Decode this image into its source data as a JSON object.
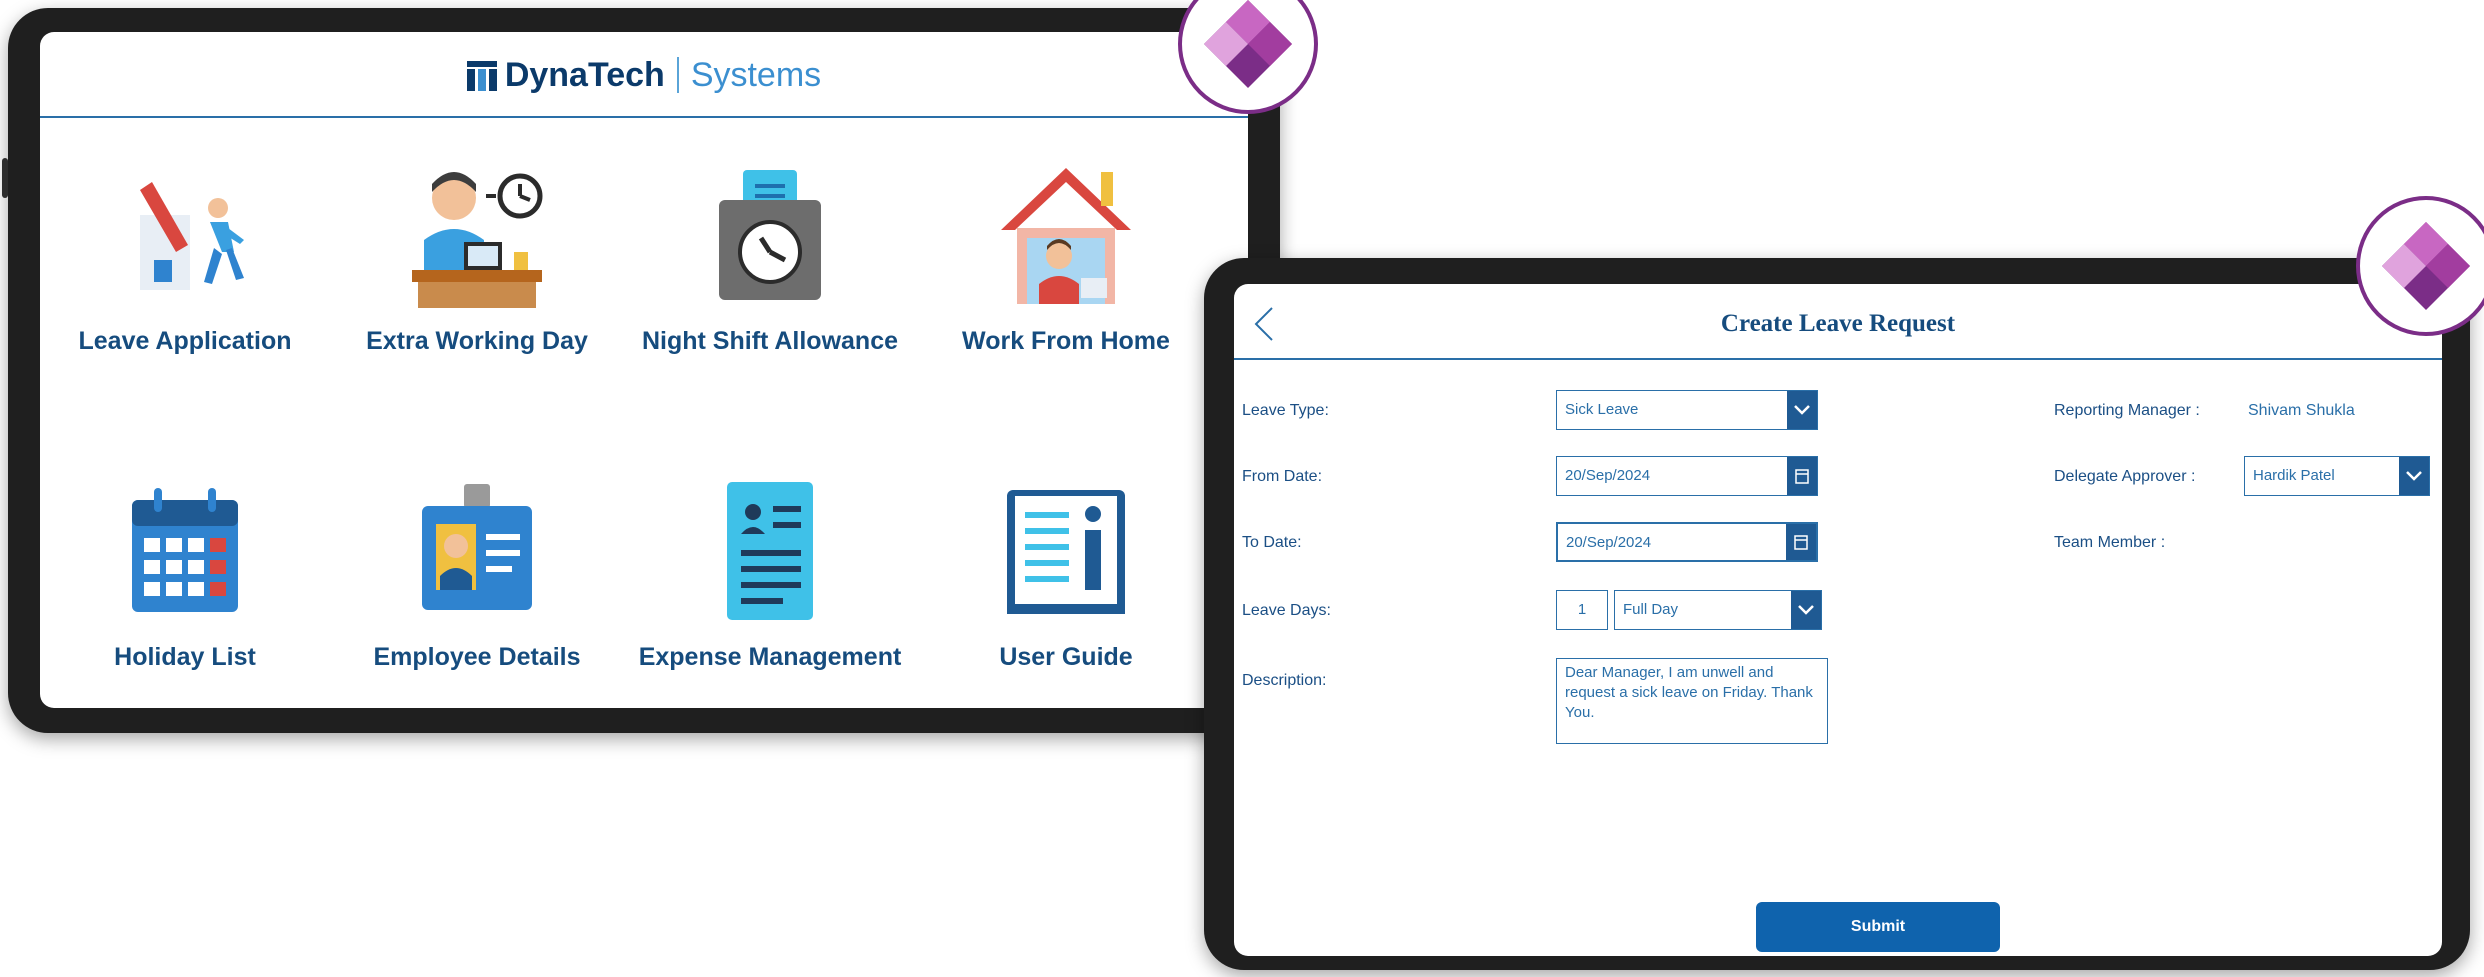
{
  "home": {
    "brand": {
      "name": "DynaTech",
      "suffix": "Systems"
    },
    "tiles": [
      {
        "label": "Leave Application",
        "icon": "leave-application-icon"
      },
      {
        "label": "Extra Working Day",
        "icon": "extra-working-day-icon"
      },
      {
        "label": "Night Shift Allowance",
        "icon": "night-shift-allowance-icon"
      },
      {
        "label": "Work From Home",
        "icon": "work-from-home-icon"
      },
      {
        "label": "Holiday List",
        "icon": "holiday-calendar-icon"
      },
      {
        "label": "Employee Details",
        "icon": "employee-id-card-icon"
      },
      {
        "label": "Expense Management",
        "icon": "expense-document-icon"
      },
      {
        "label": "User Guide",
        "icon": "user-guide-icon"
      }
    ]
  },
  "form": {
    "title": "Create Leave Request",
    "leave_type": {
      "label": "Leave Type:",
      "value": "Sick Leave"
    },
    "from_date": {
      "label": "From Date:",
      "value": "20/Sep/2024"
    },
    "to_date": {
      "label": "To Date:",
      "value": "20/Sep/2024"
    },
    "leave_days": {
      "label": "Leave Days:",
      "count": "1",
      "duration": "Full Day"
    },
    "description": {
      "label": "Description:",
      "value": "Dear Manager, I am unwell and request a sick leave on Friday. Thank You."
    },
    "reporting_manager": {
      "label": "Reporting Manager :",
      "value": "Shivam Shukla"
    },
    "delegate_approver": {
      "label": "Delegate Approver :",
      "value": "Hardik Patel"
    },
    "team_member": {
      "label": "Team Member :"
    },
    "submit_label": "Submit"
  },
  "colors": {
    "brand_navy": "#0b3a6a",
    "brand_blue": "#3b8fd0",
    "primary": "#0f63ad",
    "powerapps_purple": "#7b2d87"
  }
}
